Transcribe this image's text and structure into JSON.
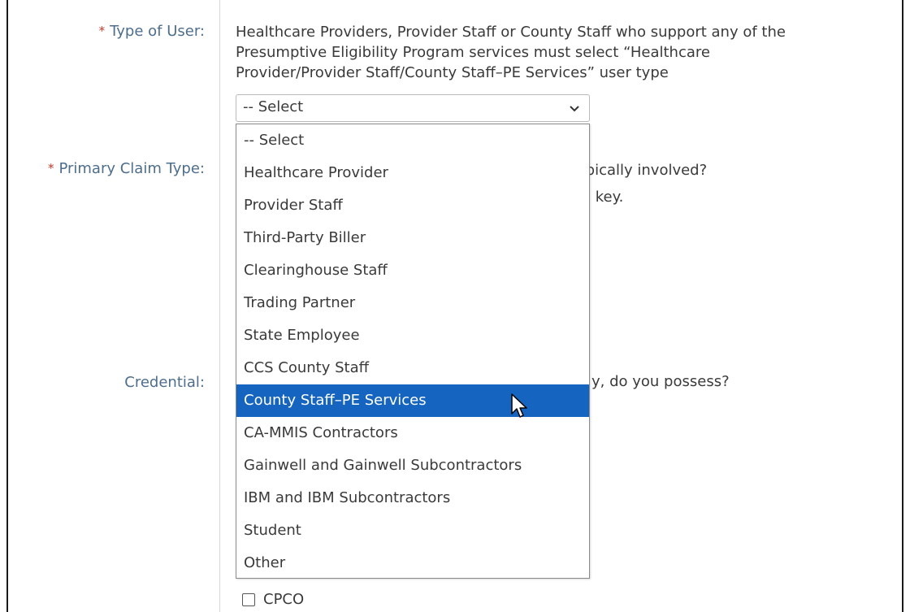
{
  "form": {
    "type_of_user": {
      "required_marker": "*",
      "label": "Type of User:",
      "help_lines": [
        "Healthcare Providers, Provider Staff or County Staff who support any of the",
        "Presumptive Eligibility Program services must select “Healthcare",
        "Provider/Provider Staff/County Staff–PE Services” user type"
      ],
      "select": {
        "selected_value": "-- Select",
        "is_open": true,
        "options": [
          "-- Select",
          "Healthcare Provider",
          "Provider Staff",
          "Third-Party Biller",
          "Clearinghouse Staff",
          "Trading Partner",
          "State Employee",
          "CCS County Staff",
          "County Staff–PE Services",
          "CA-MMIS Contractors",
          "Gainwell and Gainwell Subcontractors",
          "IBM and IBM Subcontractors",
          "Student",
          "Other"
        ],
        "highlighted_option": "County Staff–PE Services"
      }
    },
    "primary_claim_type": {
      "required_marker": "*",
      "label": "Primary Claim Type:",
      "partial_help_line1": "ypically involved?",
      "partial_help_line2": "l key."
    },
    "credential": {
      "label": "Credential:",
      "partial_help": "y, do you possess?",
      "checkbox_cpco_label": "CPCO",
      "checkbox_cpco_checked": false
    }
  },
  "colors": {
    "label": "#4d6e8c",
    "required": "#c0392b",
    "highlight": "#1565c0"
  },
  "icons": {
    "select_chevron": "chevron-down-icon",
    "mouse_pointer": "cursor-arrow-icon"
  }
}
